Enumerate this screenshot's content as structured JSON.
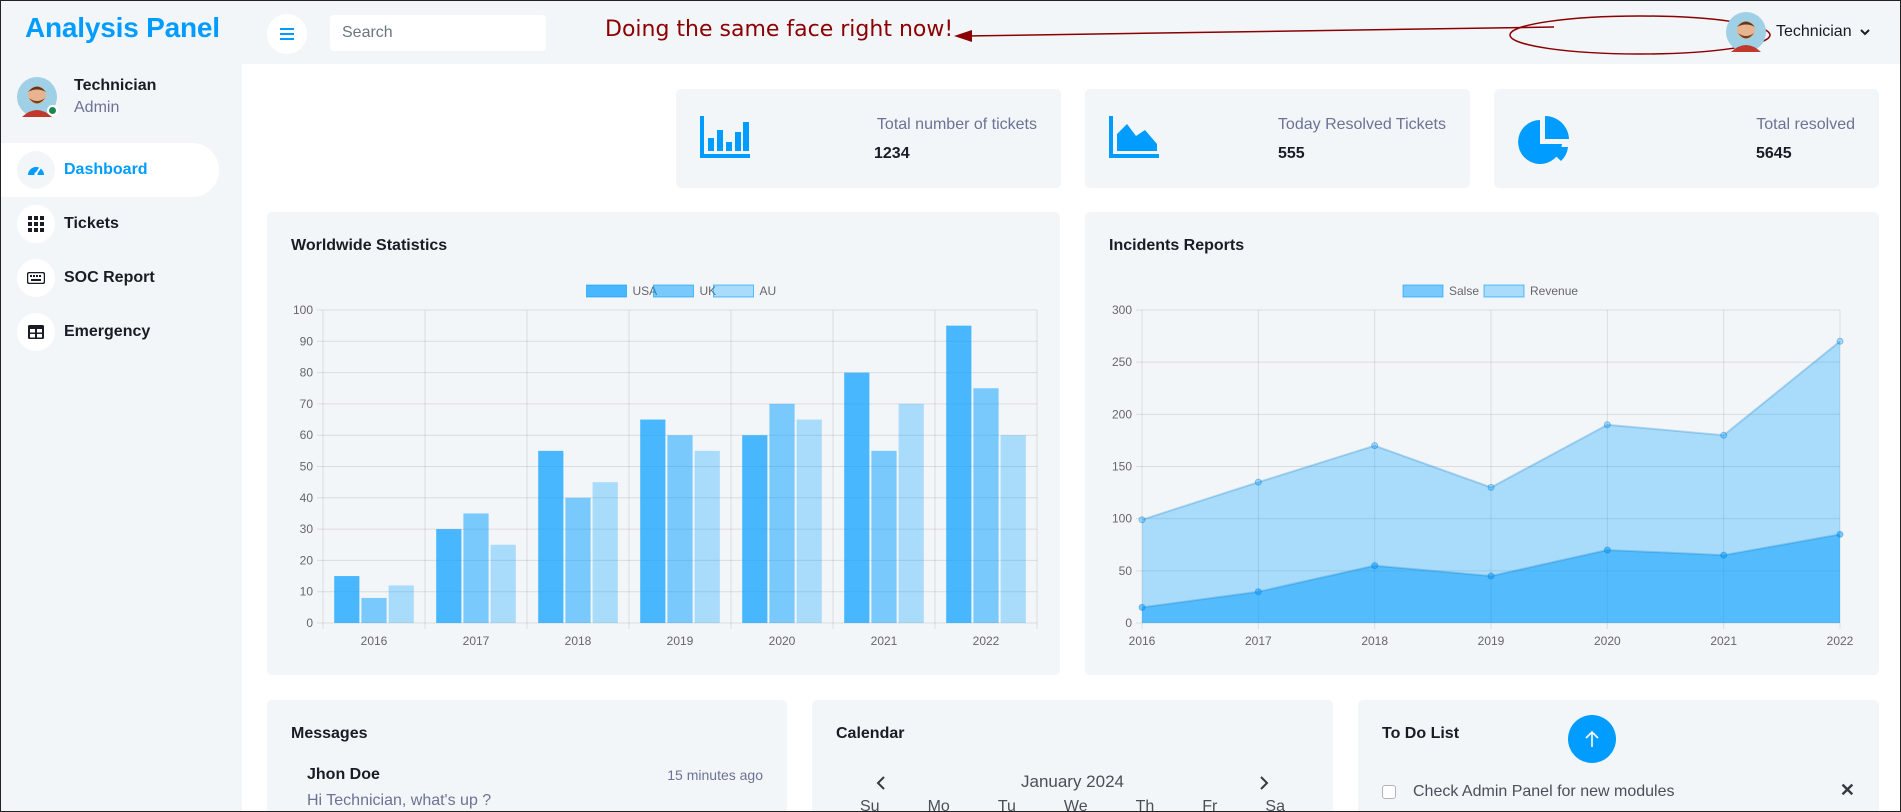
{
  "app": {
    "brand": "Analysis Panel"
  },
  "sidebar": {
    "user": {
      "name": "Technician",
      "role": "Admin"
    },
    "items": [
      {
        "label": "Dashboard",
        "icon": "dashboard-icon",
        "active": true
      },
      {
        "label": "Tickets",
        "icon": "grid-icon",
        "active": false
      },
      {
        "label": "SOC Report",
        "icon": "keyboard-icon",
        "active": false
      },
      {
        "label": "Emergency",
        "icon": "table-icon",
        "active": false
      }
    ]
  },
  "topbar": {
    "search_placeholder": "Search",
    "annotation": "Doing the same face right now!",
    "user_name": "Technician"
  },
  "stats": [
    {
      "label": "Total number of tickets",
      "value": "1234",
      "icon": "bar-chart-icon"
    },
    {
      "label": "Today Resolved Tickets",
      "value": "555",
      "icon": "area-chart-icon"
    },
    {
      "label": "Total resolved",
      "value": "5645",
      "icon": "pie-chart-icon"
    }
  ],
  "colors": {
    "accent": "#009cff",
    "panel": "#f3f6f9",
    "annotation": "#8b0000"
  },
  "chart_data": [
    {
      "title": "Worldwide Statistics",
      "type": "bar",
      "categories": [
        "2016",
        "2017",
        "2018",
        "2019",
        "2020",
        "2021",
        "2022"
      ],
      "series": [
        {
          "name": "USA",
          "values": [
            15,
            30,
            55,
            65,
            60,
            80,
            95
          ],
          "color": "rgba(0,156,255,0.7)"
        },
        {
          "name": "UK",
          "values": [
            8,
            35,
            40,
            60,
            70,
            55,
            75
          ],
          "color": "rgba(0,156,255,0.5)"
        },
        {
          "name": "AU",
          "values": [
            12,
            25,
            45,
            55,
            65,
            70,
            60
          ],
          "color": "rgba(0,156,255,0.3)"
        }
      ],
      "ylim": [
        0,
        100
      ],
      "yticks": [
        0,
        10,
        20,
        30,
        40,
        50,
        60,
        70,
        80,
        90,
        100
      ],
      "grid": true,
      "legend": "top-center"
    },
    {
      "title": "Incidents Reports",
      "type": "area",
      "x": [
        "2016",
        "2017",
        "2018",
        "2019",
        "2020",
        "2021",
        "2022"
      ],
      "series": [
        {
          "name": "Salse",
          "values": [
            15,
            30,
            55,
            45,
            70,
            65,
            85
          ],
          "color": "rgba(0,156,255,0.5)"
        },
        {
          "name": "Revenue",
          "values": [
            99,
            135,
            170,
            130,
            190,
            180,
            270
          ],
          "color": "rgba(0,156,255,0.3)"
        }
      ],
      "ylim": [
        0,
        300
      ],
      "yticks": [
        0,
        50,
        100,
        150,
        200,
        250,
        300
      ],
      "grid": true,
      "legend": "top-center"
    }
  ],
  "messages": {
    "title": "Messages",
    "items": [
      {
        "name": "Jhon Doe",
        "time": "15 minutes ago",
        "text": "Hi Technician, what's up ?"
      }
    ]
  },
  "calendar": {
    "title": "Calendar",
    "month": "January 2024",
    "days": [
      "Su",
      "Mo",
      "Tu",
      "We",
      "Th",
      "Fr",
      "Sa"
    ]
  },
  "todo": {
    "title": "To Do List",
    "items": [
      {
        "text": "Check Admin Panel for new modules",
        "done": false
      }
    ]
  }
}
